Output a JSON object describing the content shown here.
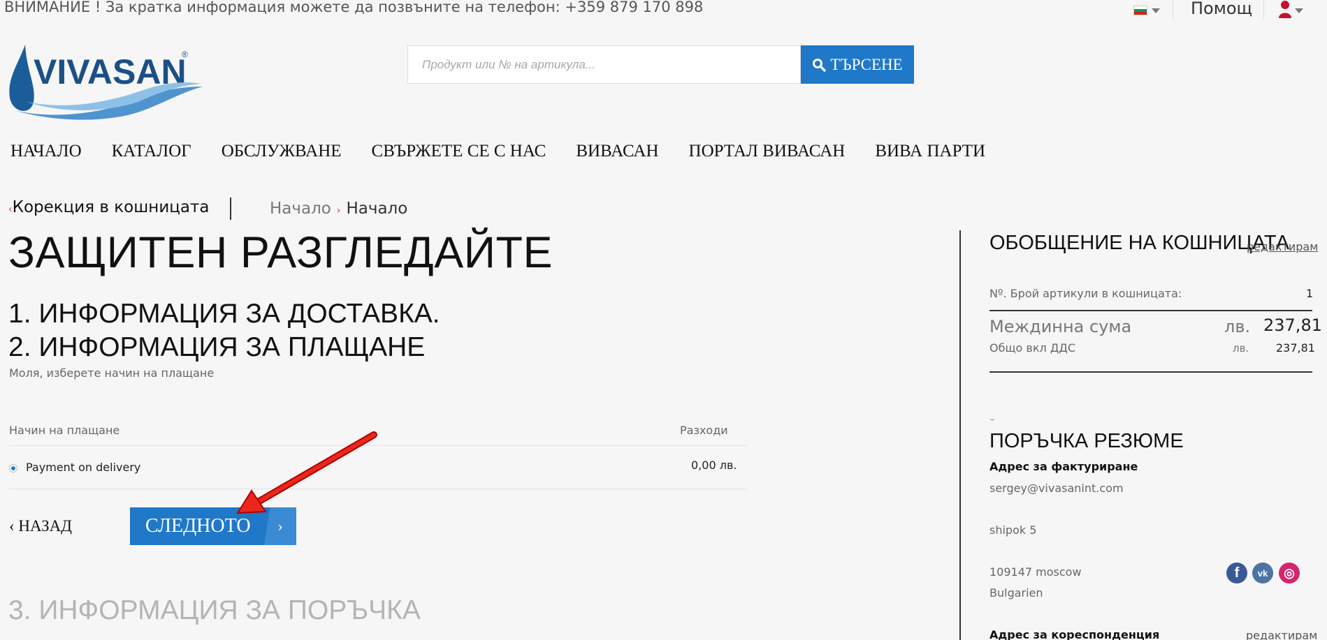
{
  "topbar": {
    "notice": "ВНИМАНИЕ ! За кратка информация можете да позвъните на телефон: +359 879 170 898",
    "help": "Помощ",
    "flag_icon": "bulgaria-flag-icon",
    "user_icon": "user-icon"
  },
  "logo": {
    "text": "VIVASAN",
    "mark": "®"
  },
  "search": {
    "placeholder": "Продукт или № на артикула...",
    "button": "ТЪРСЕНЕ"
  },
  "nav": [
    "НАЧАЛО",
    "КАТАЛОГ",
    "ОБСЛУЖВАНЕ",
    "СВЪРЖЕТЕ СЕ С НАС",
    "ВИВАСАН",
    "ПОРТАЛ ВИВАСАН",
    "ВИВА ПАРТИ"
  ],
  "breadcrumb": {
    "back": "Корекция в кошницата",
    "items": [
      "Начало",
      "Начало"
    ]
  },
  "checkout": {
    "title": "ЗАЩИТЕН РАЗГЛЕДАЙТЕ",
    "step1": "1. ИНФОРМАЦИЯ ЗА ДОСТАВКА.",
    "step2": "2. ИНФОРМАЦИЯ ЗА ПЛАЩАНЕ",
    "step2_hint": "Моля, изберете начин на плащане",
    "table_head": {
      "method": "Начин на плащане",
      "cost": "Разходи"
    },
    "payment": {
      "method": "Payment on delivery",
      "cost": "0,00 лв.",
      "selected": true
    },
    "back": "НАЗАД",
    "next": "СЛЕДНОТО",
    "step3": "3. ИНФОРМАЦИЯ ЗА ПОРЪЧКА"
  },
  "summary": {
    "title": "ОБОБЩЕНИЕ НА КОШНИЦАТА",
    "edit": "редактирам",
    "items_label": "Nº. Брой артикули в кошницата:",
    "items_count": "1",
    "subtotal_label": "Междинна сума",
    "currency": "лв.",
    "subtotal": "237,81",
    "vat_label": "Общо вкл ДДС",
    "vat_total": "237,81"
  },
  "order": {
    "dash": "–",
    "title": "ПОРЪЧКА РЕЗЮМЕ",
    "billing_title": "Адрес за фактуриране",
    "billing": [
      "sergey@vivasanint.com",
      "shipok 5",
      "109147 moscow",
      "Bulgarien"
    ],
    "corr_title": "Адрес за кореспонденция",
    "corr_edit": "редактирам"
  },
  "social": [
    {
      "icon": "facebook-icon",
      "glyph": "f",
      "color": "#3b5998"
    },
    {
      "icon": "vk-icon",
      "glyph": "vk",
      "color": "#4c75a3"
    },
    {
      "icon": "instagram-icon",
      "glyph": "◎",
      "color": "#d6246e"
    }
  ],
  "colors": {
    "primary": "#1f78c8",
    "accent_red": "#cc3333"
  }
}
